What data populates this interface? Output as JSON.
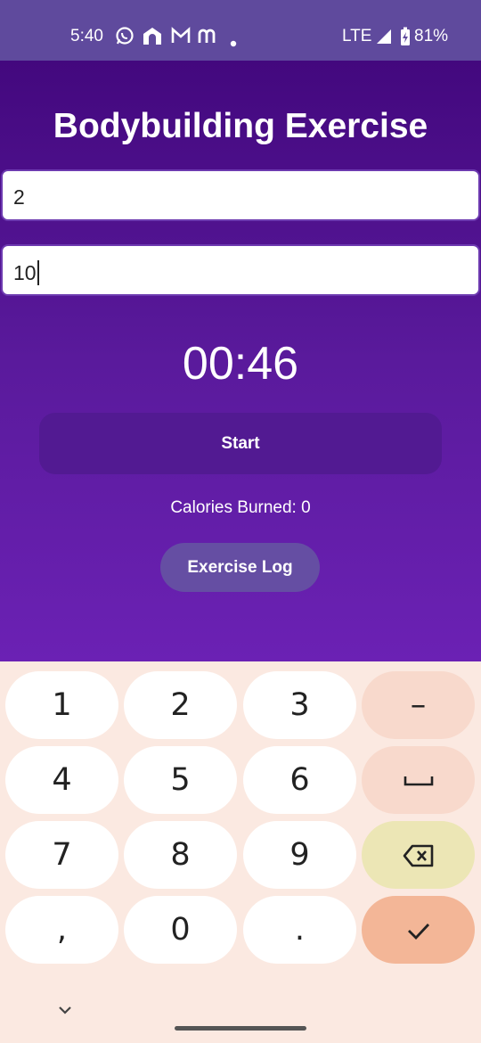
{
  "status": {
    "time": "5:40",
    "network": "LTE",
    "battery": "81%",
    "icons": [
      "whatsapp-icon",
      "home-app-icon",
      "gmail-icon",
      "m-app-icon",
      "dot-icon",
      "signal-icon",
      "battery-icon"
    ]
  },
  "app": {
    "title": "Bodybuilding Exercise",
    "field1_value": "2",
    "field2_value": "10",
    "timer": "00:46",
    "start_label": "Start",
    "calories": "Calories Burned: 0",
    "log_label": "Exercise Log"
  },
  "keyboard": {
    "keys": [
      "1",
      "2",
      "3",
      "–",
      "4",
      "5",
      "6",
      "␣",
      "7",
      "8",
      "9",
      "backspace",
      ",",
      "0",
      ".",
      "done"
    ]
  },
  "colors": {
    "status_bar": "#5f4a9d",
    "app_bg_top": "#43087e",
    "app_bg_bottom": "#6b21b4",
    "start_button": "#521a92",
    "log_button": "#654ea3",
    "keyboard_bg": "#fbe9e1",
    "key_done": "#f3b697",
    "key_backspace": "#ece6b5"
  }
}
